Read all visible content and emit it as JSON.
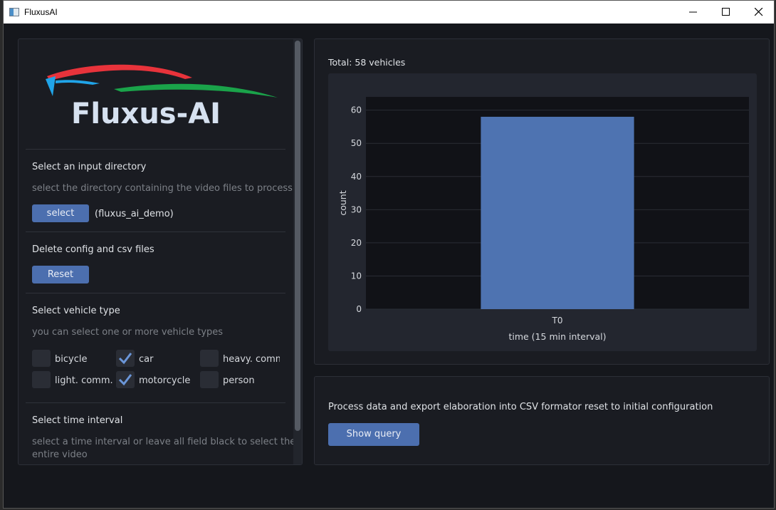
{
  "window": {
    "title": "FluxusAI"
  },
  "logo": {
    "text": "Fluxus-AI"
  },
  "input_dir": {
    "heading": "Select an input directory",
    "hint": "select the directory containing the video files to process",
    "button": "select",
    "selected": "(fluxus_ai_demo)"
  },
  "reset_section": {
    "heading": "Delete config and csv files",
    "button": "Reset"
  },
  "vehicle_section": {
    "heading": "Select vehicle type",
    "hint": "you can select one or more vehicle types",
    "options": [
      {
        "label": "bicycle",
        "checked": false
      },
      {
        "label": "car",
        "checked": true
      },
      {
        "label": "heavy. comm",
        "checked": false
      },
      {
        "label": "light. comm. v",
        "checked": false
      },
      {
        "label": "motorcycle",
        "checked": true
      },
      {
        "label": "person",
        "checked": false
      }
    ]
  },
  "time_section": {
    "heading": "Select time interval",
    "hint_line1": "select a time interval or leave all field black to select the",
    "hint_line2": "entire video"
  },
  "summary": {
    "total": "Total: 58 vehicles"
  },
  "chart_data": {
    "type": "bar",
    "categories": [
      "T0"
    ],
    "values": [
      58
    ],
    "xlabel": "time (15 min interval)",
    "ylabel": "count",
    "ylim": [
      0,
      64
    ],
    "yticks": [
      0,
      10,
      20,
      30,
      40,
      50,
      60
    ],
    "grid": true,
    "bar_color": "#4e73b1"
  },
  "process": {
    "text": "Process data and export elaboration into CSV formator reset to initial configuration",
    "button": "Show query"
  },
  "colors": {
    "accent": "#4c6faf",
    "background": "#15171c",
    "panel": "#1a1c22"
  }
}
